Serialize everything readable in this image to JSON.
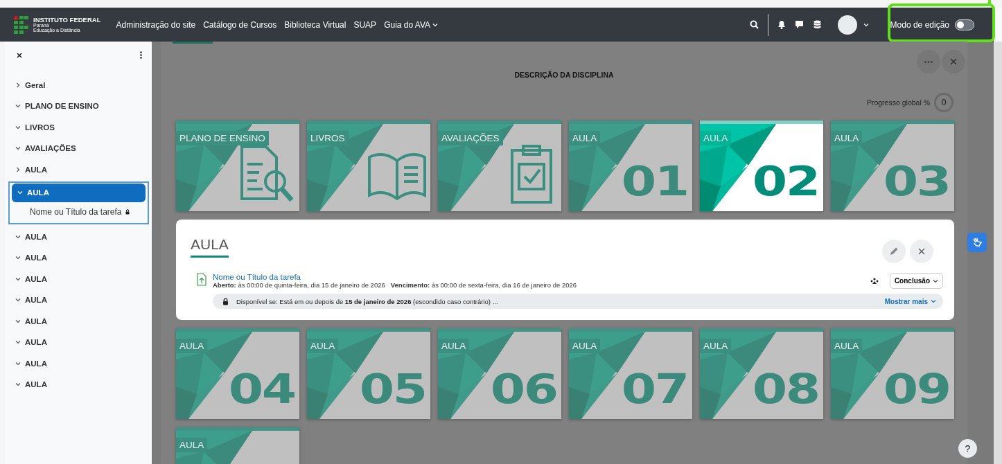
{
  "navbar": {
    "logo": {
      "title": "INSTITUTO FEDERAL",
      "line_1": "Paraná",
      "line_2": "Educação a Distância"
    },
    "links": [
      {
        "label": "Administração do site",
        "dropdown": false
      },
      {
        "label": "Catálogo de Cursos",
        "dropdown": false
      },
      {
        "label": "Biblioteca Virtual",
        "dropdown": false
      },
      {
        "label": "SUAP",
        "dropdown": false
      },
      {
        "label": "Guia do AVA",
        "dropdown": true
      }
    ],
    "edit_mode": {
      "label": "Modo de edição",
      "on": false,
      "highlighted": true
    }
  },
  "sidebar": {
    "items": [
      {
        "label": "Geral",
        "expanded": false,
        "selected": false
      },
      {
        "label": "PLANO DE ENSINO",
        "expanded": true,
        "selected": false
      },
      {
        "label": "LIVROS",
        "expanded": true,
        "selected": false
      },
      {
        "label": "AVALIAÇÕES",
        "expanded": true,
        "selected": false
      },
      {
        "label": "AULA",
        "expanded": false,
        "selected": false
      },
      {
        "label": "AULA",
        "expanded": true,
        "selected": true,
        "children": [
          {
            "label": "Nome ou Título da tarefa",
            "locked": true
          }
        ]
      },
      {
        "label": "AULA",
        "expanded": true,
        "selected": false
      },
      {
        "label": "AULA",
        "expanded": true,
        "selected": false
      },
      {
        "label": "AULA",
        "expanded": true,
        "selected": false
      },
      {
        "label": "AULA",
        "expanded": true,
        "selected": false
      },
      {
        "label": "AULA",
        "expanded": true,
        "selected": false
      },
      {
        "label": "AULA",
        "expanded": true,
        "selected": false
      },
      {
        "label": "AULA",
        "expanded": true,
        "selected": false
      },
      {
        "label": "AULA",
        "expanded": true,
        "selected": false
      }
    ]
  },
  "course": {
    "title": "DESCRIÇÃO DA DISCIPLINA",
    "progress": {
      "label": "Progresso global %",
      "value": "0"
    },
    "tiles_top": [
      {
        "label": "PLANO DE ENSINO",
        "kind": "document",
        "selected": false
      },
      {
        "label": "LIVROS",
        "kind": "book",
        "selected": false
      },
      {
        "label": "AVALIAÇÕES",
        "kind": "clipboard",
        "selected": false
      },
      {
        "label": "AULA",
        "kind": "number",
        "number": "01",
        "selected": false
      },
      {
        "label": "AULA",
        "kind": "number",
        "number": "02",
        "selected": true
      },
      {
        "label": "AULA",
        "kind": "number",
        "number": "03",
        "selected": false
      }
    ],
    "section": {
      "title": "AULA",
      "activity": {
        "name": "Nome ou Título da tarefa",
        "open_label": "Aberto:",
        "open_value": "às 00:00 de quinta-feira, dia 15 de janeiro de 2026",
        "due_label": "Vencimento:",
        "due_value": "às 00:00 de sexta-feira, dia 16 de janeiro de 2026",
        "completion": "Conclusão",
        "restriction": "Disponível se: Está em ou depois de **15 de janeiro de 2026** (escondido caso contrário) ...",
        "show_more": "Mostrar mais"
      }
    },
    "tiles_bottom": [
      {
        "label": "AULA",
        "kind": "number",
        "number": "04",
        "selected": false
      },
      {
        "label": "AULA",
        "kind": "number",
        "number": "05",
        "selected": false
      },
      {
        "label": "AULA",
        "kind": "number",
        "number": "06",
        "selected": false
      },
      {
        "label": "AULA",
        "kind": "number",
        "number": "07",
        "selected": false
      },
      {
        "label": "AULA",
        "kind": "number",
        "number": "08",
        "selected": false
      },
      {
        "label": "AULA",
        "kind": "number",
        "number": "09",
        "selected": false
      },
      {
        "label": "AULA",
        "kind": "number",
        "selected": false
      }
    ]
  },
  "help": "?"
}
